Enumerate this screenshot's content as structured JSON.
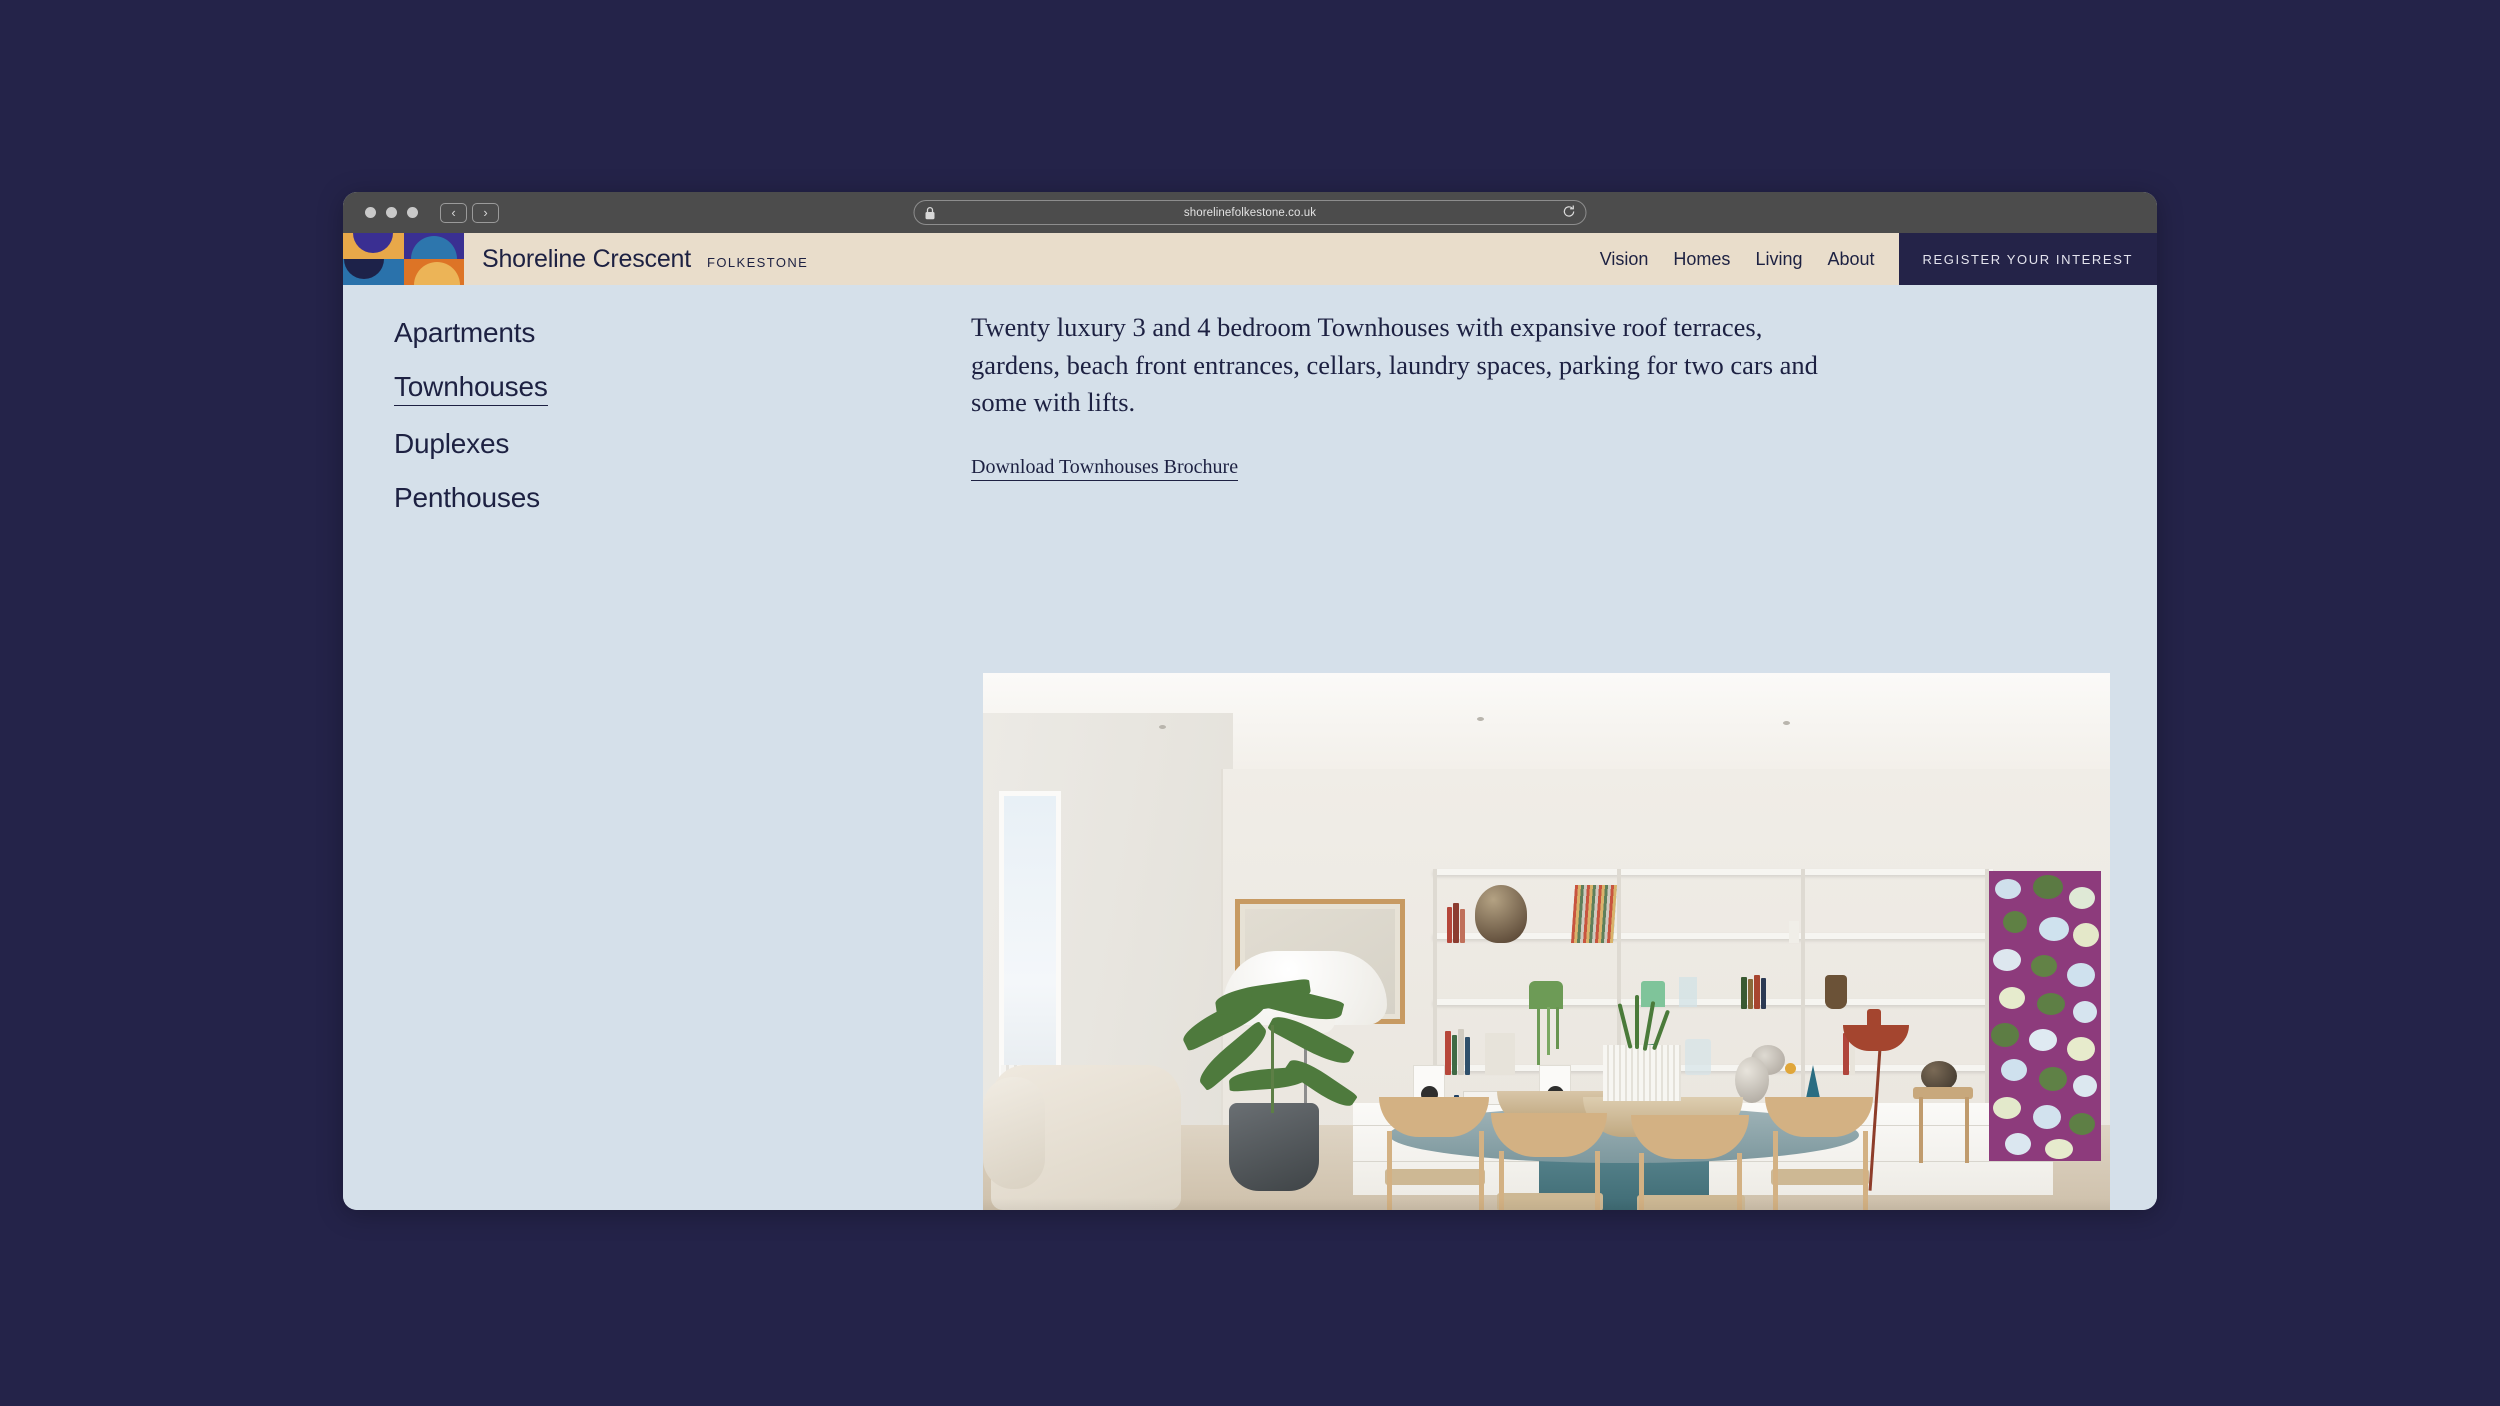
{
  "browser": {
    "url": "shorelinefolkestone.co.uk",
    "lock_icon": "lock-icon",
    "reload_icon": "reload-icon",
    "back_icon": "‹",
    "forward_icon": "›",
    "traffic_light_count": 3
  },
  "header": {
    "brand_name": "Shoreline Crescent",
    "brand_location": "FOLKESTONE",
    "nav": [
      {
        "label": "Vision"
      },
      {
        "label": "Homes"
      },
      {
        "label": "Living"
      },
      {
        "label": "About"
      }
    ],
    "register_label": "REGISTER YOUR INTEREST"
  },
  "sidebar": {
    "items": [
      {
        "label": "Apartments",
        "active": false
      },
      {
        "label": "Townhouses",
        "active": true
      },
      {
        "label": "Duplexes",
        "active": false
      },
      {
        "label": "Penthouses",
        "active": false
      }
    ]
  },
  "content": {
    "intro": "Twenty luxury 3 and 4 bedroom Townhouses with expansive roof terraces, gardens, beach front entrances, cellars, laundry spaces, parking for two cars and some with lifts.",
    "brochure_link": "Download Townhouses Brochure"
  },
  "photo": {
    "alt": "Townhouse interior with dining table, shelving unit, plants and abstract painting"
  },
  "colors": {
    "page_background": "#d5e0ea",
    "header_cream": "#e9ddcb",
    "navy": "#242348",
    "desktop_navy": "#242349",
    "toolbar_grey": "#4c4c4c",
    "text_navy": "#1d2142",
    "logo_orange": "#e8a849",
    "logo_indigo": "#3a3092",
    "logo_blue": "#2a72ab",
    "logo_burnt": "#dd7426"
  }
}
